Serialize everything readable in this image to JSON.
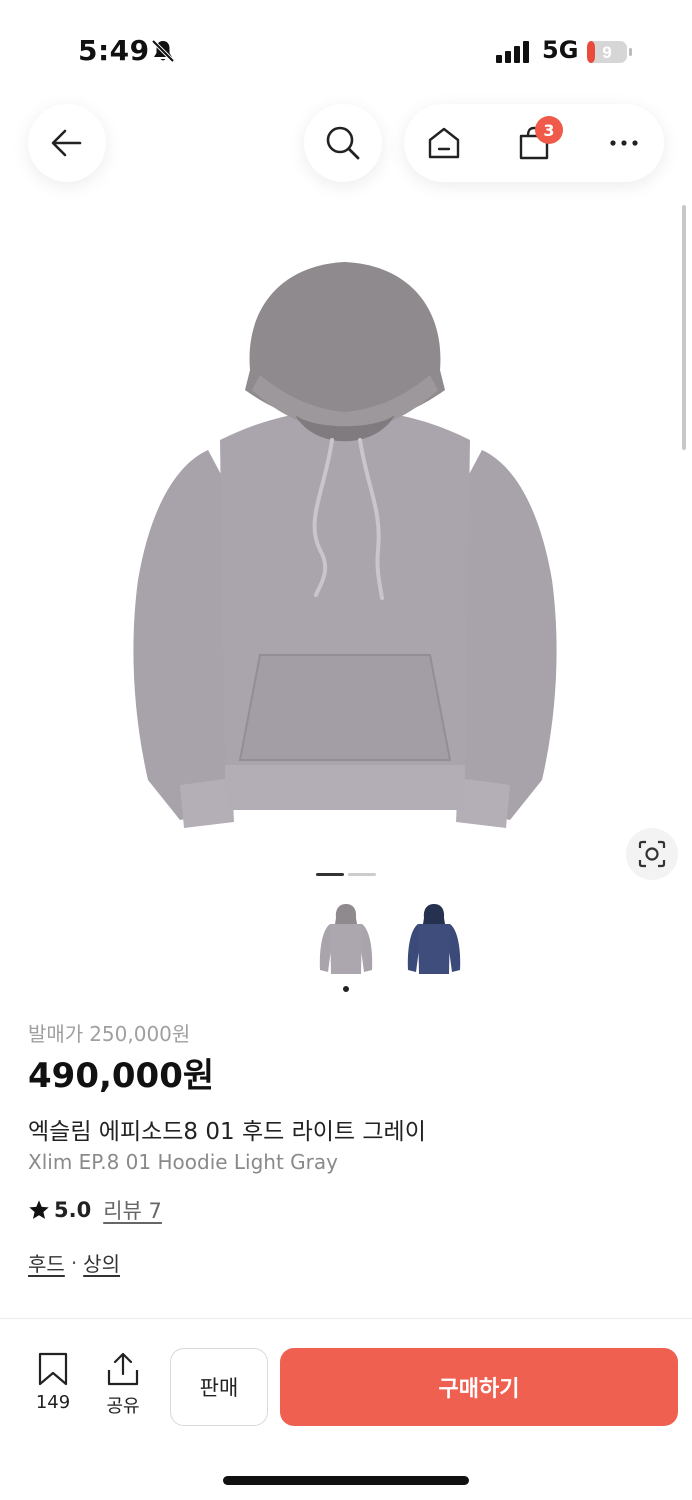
{
  "status_bar": {
    "time": "5:49",
    "network": "5G",
    "battery_level": "9",
    "icons": [
      "bell-slash-icon",
      "signal-bars-icon",
      "battery-icon"
    ]
  },
  "nav": {
    "icons": [
      "back-arrow-icon",
      "search-icon",
      "home-icon",
      "shopping-bag-icon",
      "more-icon"
    ],
    "cart_count": "3"
  },
  "gallery": {
    "image_name": "light gray hoodie",
    "page_count": 2,
    "active_page": 1,
    "thumbnails": [
      {
        "color": "#a9a3ab",
        "active": true
      },
      {
        "color": "#3b4a78",
        "active": false
      }
    ]
  },
  "product": {
    "release_label": "발매가",
    "release_price": "250,000원",
    "price": "490,000원",
    "name_ko": "엑슬림 에피소드8 01 후드 라이트 그레이",
    "name_en": "Xlim EP.8 01 Hoodie Light Gray",
    "rating": "5.0",
    "reviews_label": "리뷰 7",
    "categories": [
      "후드",
      "상의"
    ],
    "category_separator": "·"
  },
  "bottom_bar": {
    "bookmark_count": "149",
    "share_label": "공유",
    "sell_label": "판매",
    "buy_label": "구매하기"
  },
  "colors": {
    "accent": "#ef6050",
    "badge": "#ef5a4b",
    "hoodie": "#a9a3ab",
    "hoodie_navy": "#3b4a78"
  }
}
